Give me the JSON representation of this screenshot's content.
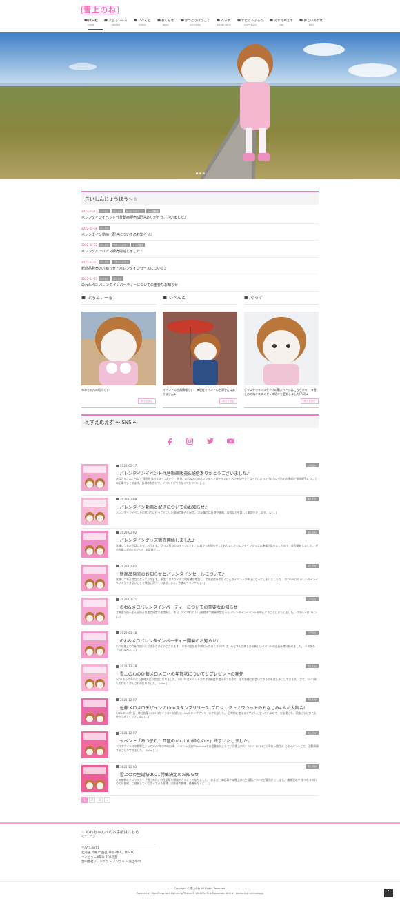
{
  "site": {
    "logo_text": "雪上のね"
  },
  "nav": [
    {
      "label": "ほーむ",
      "sub": "HOME",
      "icon": "home-icon"
    },
    {
      "label": "ぷろふぃーる",
      "sub": "PROFILE",
      "icon": "id-card-icon"
    },
    {
      "label": "いべんと",
      "sub": "EVENT",
      "icon": "calendar-icon"
    },
    {
      "label": "おしらせ",
      "sub": "NEWS",
      "icon": "megaphone-icon"
    },
    {
      "label": "かつどうほうこく",
      "sub": "ACTIVITIES",
      "icon": "pencil-icon"
    },
    {
      "label": "ぐっず",
      "sub": "ONLINE SHOP",
      "icon": "cart-icon"
    },
    {
      "label": "すたっふぶろぐ",
      "sub": "STAFF BLOG",
      "icon": "edit-icon"
    },
    {
      "label": "えすえぬえす",
      "sub": "SNS",
      "icon": "star-icon"
    },
    {
      "label": "おといあわせ",
      "sub": "INFO",
      "icon": "mail-icon"
    }
  ],
  "updates": {
    "heading": "さいしんじょうほう～☆",
    "items": [
      {
        "date": "2022-02-17",
        "tags": [
          "いべんと",
          "おしらせ",
          "かつどうほうこく",
          "ぐっず販売"
        ],
        "title": "バレンタインイベント代替動画販売&配信ありがとうございました♪"
      },
      {
        "date": "2022-02-08",
        "tags": [
          "おしらせ"
        ],
        "title": "バレンタイン動画と配信についてのお知らせ♪"
      },
      {
        "date": "2022-02-02",
        "tags": [
          "おしらせ",
          "すたっふぶろぐ",
          "ぐっず販売"
        ],
        "title": "バレンタイングッズ販売開始しました♪"
      },
      {
        "date": "2022-02-01",
        "tags": [
          "おしらせ",
          "すたっふぶろぐ"
        ],
        "title": "新商品発売のお知らせとバレンタインセールについて♪"
      },
      {
        "date": "2022-01-21",
        "tags": [
          "いべんと",
          "おしらせ"
        ],
        "title": "のわ&メロ バレンタインパーティーについての重要なお知らせ"
      }
    ]
  },
  "columns": [
    {
      "heading": "ぷろふぃーる",
      "icon": "id-card-icon",
      "caption": "のわちゃんの紹介です！",
      "more": "続きを読む"
    },
    {
      "heading": "いべんと",
      "icon": "calendar-icon",
      "caption": "イベントの出演情報です！ ★現在イベントの出演予定はありません★",
      "more": "続きを読む"
    },
    {
      "heading": "ぐっず",
      "icon": "cart-icon",
      "caption": "グッズやラインスタンプの購入ページはこちらから！ ★雪上ののねオススメグッズ紹介を更新しました(7/3)★",
      "more": "続きを読む"
    }
  ],
  "sns": {
    "heading": "えすえぬえす ～ SNS ～",
    "icons": [
      "facebook-icon",
      "instagram-icon",
      "twitter-icon",
      "youtube-icon"
    ]
  },
  "posts": [
    {
      "date": "2022-02-17",
      "badge": "いべんと",
      "title": "バレンタインイベント代替動画販売&配信ありがとうございました♪",
      "excerpt": "みなさんこんにちは！ 運営担当のスタッフAです！ 先日、のわ&メロのバレンタインパーティのイベントが中止となってしまった代わりに行われた動画と動画販売について本記事でまとめます。皆様のおかげで、イベントができなくてもイベン [...]"
    },
    {
      "date": "2022-02-08",
      "badge": "おしらせ",
      "title": "バレンタイン動画と配信についてのお知らせ♪",
      "excerpt": "バレンタインイベントの代わりに行うことにした動画の販売と配信。 本記事では日時や価格、内容などを詳しく解説いたします。 & [...]"
    },
    {
      "date": "2022-02-02",
      "badge": "おしらせ",
      "title": "バレンタイングッズ販売開始しました♪",
      "excerpt": "皆様いつもお世話になっております。 グッズ担当のスタッフAです。 以前からお知らせしておりましたバレンタイングッズの準備が整いましたので、販売開始しました。 ぜひお買い求めください！ 本記事で [...]"
    },
    {
      "date": "2022-02-01",
      "badge": "おしらせ",
      "title": "新商品発売のお知らせとバレンタインセールについて♪",
      "excerpt": "皆様いつもお世話になっております。 新型コロナウイルス陽性者が増加し、北海道は外でたくさんのイベントが中止になってしまいましたね… のわ&メロもバレンタインイベントができないことを残念に思っています。また、今後のイベントの [...]"
    },
    {
      "date": "2022-01-21",
      "badge": "いべんと",
      "title": "のわ&メロバレンタインパーティーについての重要なお知らせ",
      "excerpt": "北海道が国へまん延防止等重点措置の要請をし、本日、2022年2月12日札幌市で開催予定だった バレンタインイベントを中止することにいたしました。 のわ&メロバレン [...]"
    },
    {
      "date": "2022-01-18",
      "badge": "いべんと",
      "title": "のわ&メロバレンタインパーティー開催のお知らせ♪",
      "excerpt": "いつも雪上のねを応援いただきありがとうございます。 のわの生誕祭が終わったあとすぐ2人は、みなさんが楽しめる新しいイベントの企画を考え始めました。 その名も「のわ&メロ [...]"
    },
    {
      "date": "2021-12-28",
      "badge": "おしらせ",
      "title": "雪上のわの佐藤メロメロへの年賀状についてとプレゼントの発先",
      "excerpt": "2021年ものわのとも皆様大変お世話になりました。2022年はイベントができる機会が増えそうなので、まだ皆様とお会いできるのを楽しみにしています。 さて、2021年ものわもうがんばれの打ちでした。 &nbs [...]"
    },
    {
      "date": "2021-12-07",
      "badge": "おしらせ",
      "title": "佐藤メロメロデザインのLineスタンプリリース!プロジェクトノワウットのおなじみ4人が大集合!",
      "excerpt": "2021年12月7日、弊社佐藤メロメロがイラストを描いたLineスタンプがリリースされました。 日常的に使えるデザインになっているので、お友達にも、家族にもぜひとも使ってみてくださいね♪ [...]"
    },
    {
      "date": "2021-12-07",
      "badge": "おしらせ",
      "title": "イベント「あつまれ！西区のかわいい娘なの～」終了いたしました。",
      "excerpt": "コロナウイルスの影響によって2020年の中旬以降、イベント出演やYoutubeでの活動を休止していた雪上のわ。2021.11.14にくそれっ娘さん とのイベントにて、活動再開することができました。 &nbs [...]"
    },
    {
      "date": "2021-12-03",
      "badge": "おしらせ",
      "title": "雪上のわ生誕祭2021開催決定のお知らせ",
      "excerpt": "この度弊社キャラクター「雪上のわ」の生誕祭を開催できることとなりました。 および、本記事では雪上のわ生誕祭についてご案内いたします。 諸状況の中 すぐれるのわのとも皆様、ご理解してくださっている皆様、活動者の皆様、最善を尽くご [...]"
    }
  ],
  "pagination": {
    "pages": [
      "1",
      "2",
      "3",
      "»"
    ],
    "current": "1"
  },
  "footer": {
    "letter_heading": "♡ のわちゃんへのお手紙はこちら",
    "kaomoji": "＜^__^＞",
    "postal": "〒063-0813",
    "address1": "北海道 札幌市 西区 琴似3条1丁目6-10",
    "address2": "エイビューⅢ琴似 101号室",
    "company": "合同会社プロジェクト ノワウット 雪上のわ",
    "copyright": "Copyright © 雪上のわ All Rights Reserved.",
    "powered_by": "Powered by WordPress with Lightning Theme & VK All in One Expansion Unit by Vektor,Inc. technology."
  },
  "colors": {
    "accent": "#f06fb8",
    "tag": "#999999",
    "date": "#d6517e"
  }
}
